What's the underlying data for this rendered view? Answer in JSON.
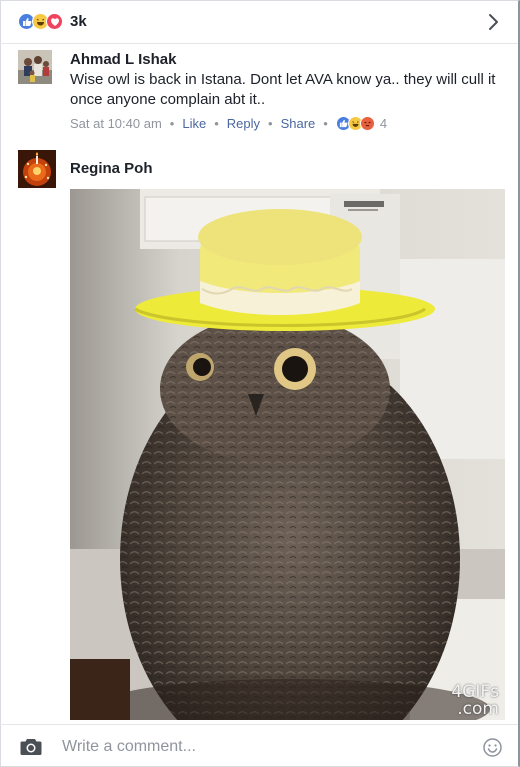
{
  "reactions": {
    "types": [
      "like-icon",
      "haha-icon",
      "love-icon"
    ],
    "count": "3k"
  },
  "comments": [
    {
      "author": "Ahmad L Ishak",
      "text": "Wise owl is back in Istana. Dont let AVA know ya.. they will cull it once anyone complain abt it..",
      "time": "Sat at 10:40 am",
      "like_label": "Like",
      "reply_label": "Reply",
      "share_label": "Share",
      "reaction_types": [
        "like-icon",
        "haha-icon",
        "angry-icon"
      ],
      "reaction_count": "4"
    },
    {
      "author": "Regina Poh",
      "attachment": {
        "kind": "gif",
        "subject": "owl wearing a yellow sun hat",
        "watermark_line1": "4GIFs",
        "watermark_line2": ".com"
      }
    }
  ],
  "composer": {
    "placeholder": "Write a comment..."
  },
  "colors": {
    "like": "#4a7fe0",
    "haha": "#f7c844",
    "love": "#f0435d",
    "angry": "#e9603f",
    "link": "#4b67a1",
    "meta": "#90949c"
  }
}
